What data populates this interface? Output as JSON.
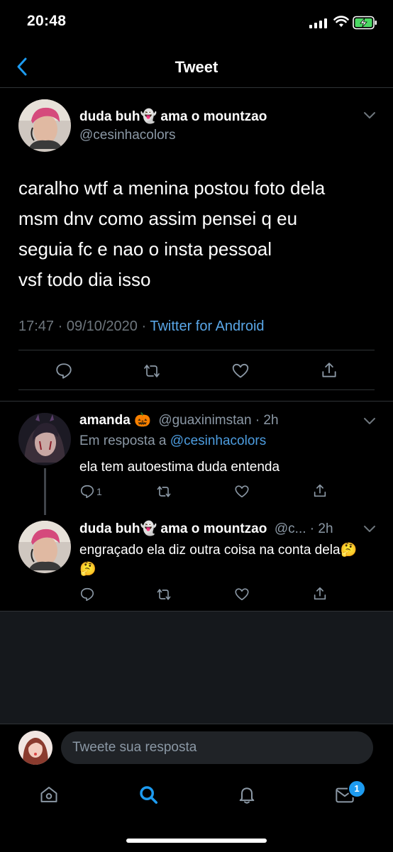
{
  "status_bar": {
    "time": "20:48"
  },
  "nav": {
    "title": "Tweet"
  },
  "main_tweet": {
    "name": "duda buh👻 ama o mountzao",
    "handle": "@cesinhacolors",
    "text": "caralho wtf a menina postou foto dela\nmsm dnv como assim pensei q eu\nseguia fc e nao o insta pessoal\nvsf todo dia isso",
    "time": "17:47 · 09/10/2020 · ",
    "source": "Twitter for Android"
  },
  "replies": [
    {
      "name": "amanda 🎃",
      "handle": "@guaxinimstan · 2h",
      "reply_to_label": "Em resposta a ",
      "reply_to_user": "@cesinhacolors",
      "text": "ela tem autoestima duda entenda",
      "reply_count": "1"
    },
    {
      "name": "duda buh👻 ama o mountzao",
      "handle": "@c... · 2h",
      "text": "engraçado ela diz outra coisa na conta dela🤔 🤔"
    }
  ],
  "compose": {
    "placeholder": "Tweete sua resposta"
  },
  "tabbar": {
    "messages_badge": "1"
  },
  "colors": {
    "accent": "#1d9bf0",
    "link": "#4d9de0",
    "muted": "#8b98a5",
    "background": "#000000"
  }
}
